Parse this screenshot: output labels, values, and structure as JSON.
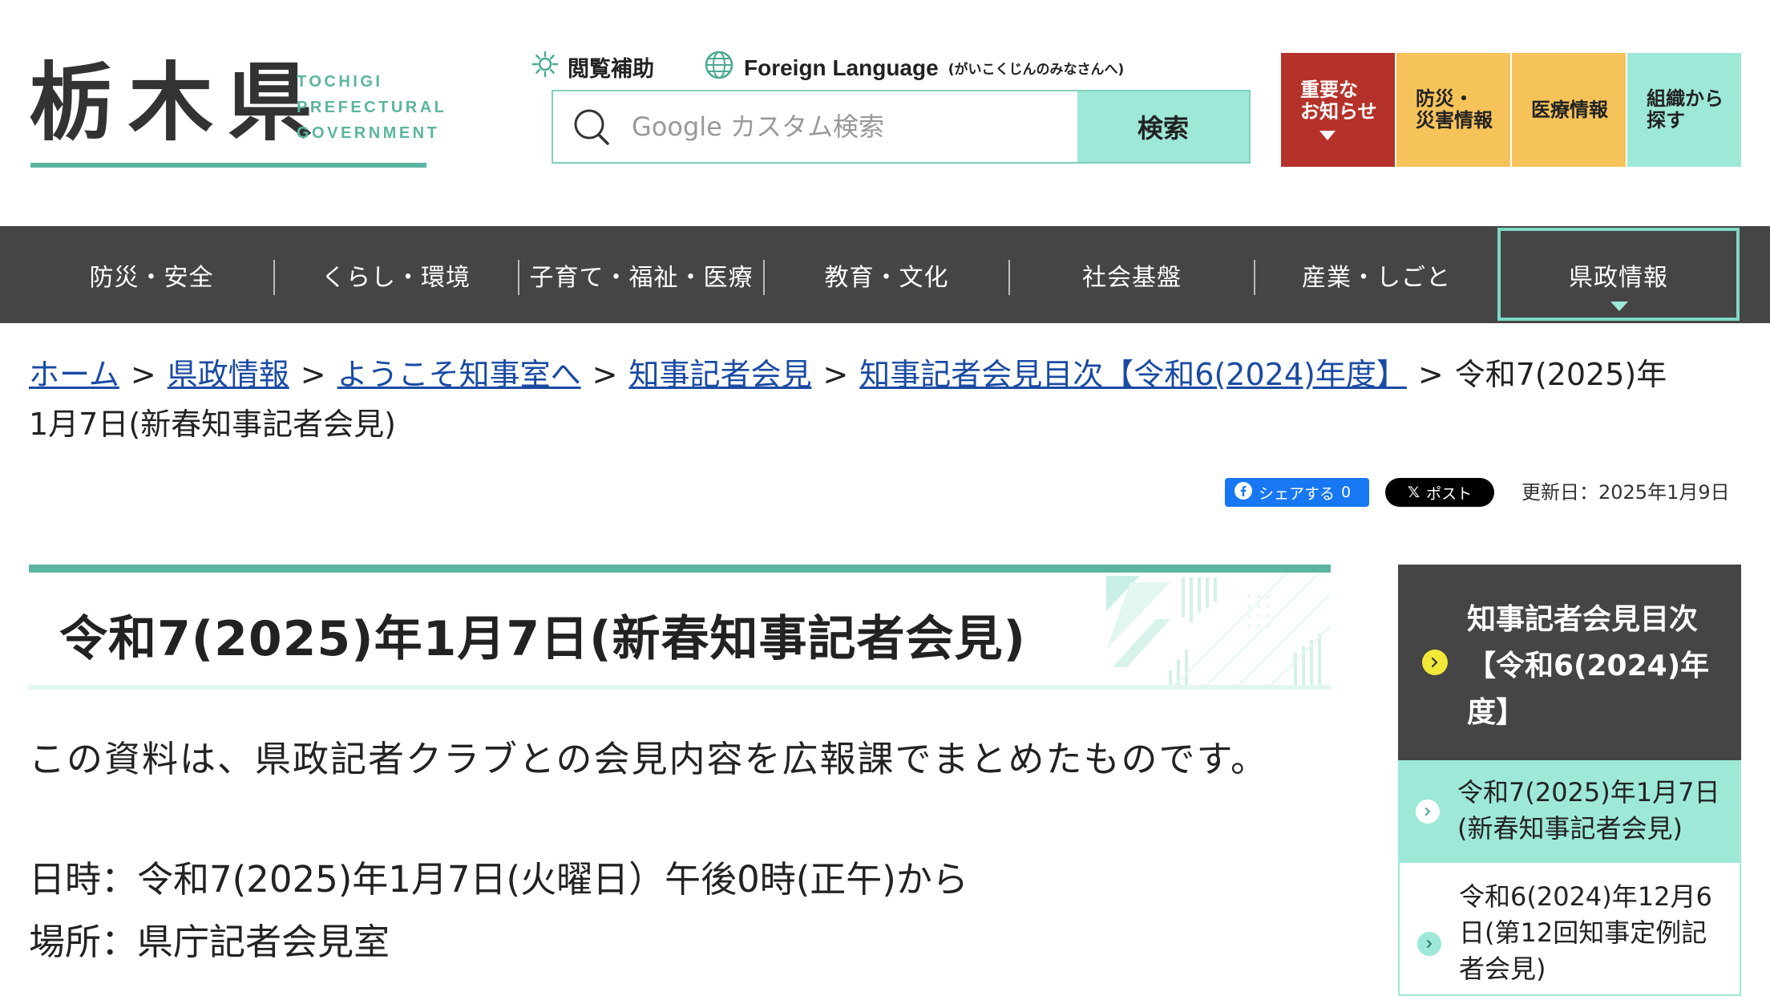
{
  "header": {
    "logo_kanji": "栃木県",
    "logo_en_1": "TOCHIGI",
    "logo_en_2": "PREFECTURAL",
    "logo_en_3": "GOVERNMENT",
    "accessibility_label": "閲覧補助",
    "language_label": "Foreign Language",
    "language_sub": "(がいこくじんのみなさんへ)",
    "search_placeholder": "Google カスタム検索",
    "search_button": "検索",
    "quick_links": [
      {
        "line1": "重要な",
        "line2": "お知らせ",
        "color": "#b5322a"
      },
      {
        "line1": "防災・",
        "line2": "災害情報",
        "color": "#f5c35a"
      },
      {
        "line1": "医療情報",
        "line2": "",
        "color": "#f5c35a"
      },
      {
        "line1": "組織から",
        "line2": "探す",
        "color": "#9ee8d8"
      }
    ]
  },
  "nav": {
    "items": [
      "防災・安全",
      "くらし・環境",
      "子育て・福祉・医療",
      "教育・文化",
      "社会基盤",
      "産業・しごと",
      "県政情報"
    ],
    "active": "県政情報"
  },
  "breadcrumb": {
    "links": [
      "ホーム",
      "県政情報",
      "ようこそ知事室へ",
      "知事記者会見",
      "知事記者会見目次【令和6(2024)年度】"
    ],
    "separator": ">",
    "current_1": "令和7(2025)年",
    "current_2": "1月7日(新春知事記者会見)"
  },
  "share": {
    "facebook": "シェアする",
    "facebook_count": "0",
    "x": "ポスト",
    "updated": "更新日：2025年1月9日"
  },
  "main": {
    "title": "令和7(2025)年1月7日(新春知事記者会見)",
    "lead": "この資料は、県政記者クラブとの会見内容を広報課でまとめたものです。",
    "datetime": "日時：令和7(2025)年1月7日(火曜日）午後0時(正午)から",
    "place": "場所：県庁記者会見室"
  },
  "sidebar": {
    "heading_1": "知事記者会見目次",
    "heading_2": "【令和6(2024)年",
    "heading_3": "度】",
    "items": [
      {
        "line1": "令和7(2025)年1月7日",
        "line2": "(新春知事記者会見)",
        "line3": ""
      },
      {
        "line1": "令和6(2024)年12月6",
        "line2": "日(第12回知事定例記",
        "line3": "者会見)"
      }
    ]
  },
  "colors": {
    "accent_green": "#5bb5a0",
    "mint": "#9ee8d8",
    "nav_bg": "#454545",
    "alert_red": "#b5322a",
    "yellow": "#f5c35a",
    "link_blue": "#1a4ba3"
  }
}
